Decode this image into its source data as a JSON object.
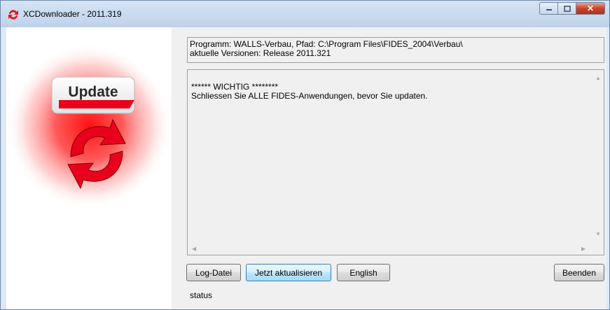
{
  "window": {
    "title": "XCDownloader - 2011.319"
  },
  "logo": {
    "label": "Update"
  },
  "info": {
    "line1": "Programm: WALLS-Verbau, Pfad: C:\\Program Files\\FIDES_2004\\Verbau\\",
    "line2": "aktuelle Versionen: Release 2011.321"
  },
  "message": {
    "text": "****** WICHTIG ********\nSchliessen Sie ALLE FIDES-Anwendungen, bevor Sie updaten."
  },
  "buttons": {
    "log": "Log-Datei",
    "update": "Jetzt aktualisieren",
    "english": "English",
    "quit": "Beenden"
  },
  "status": "status",
  "colors": {
    "accent": "#e8001c",
    "title_bar": "#c9daef"
  }
}
